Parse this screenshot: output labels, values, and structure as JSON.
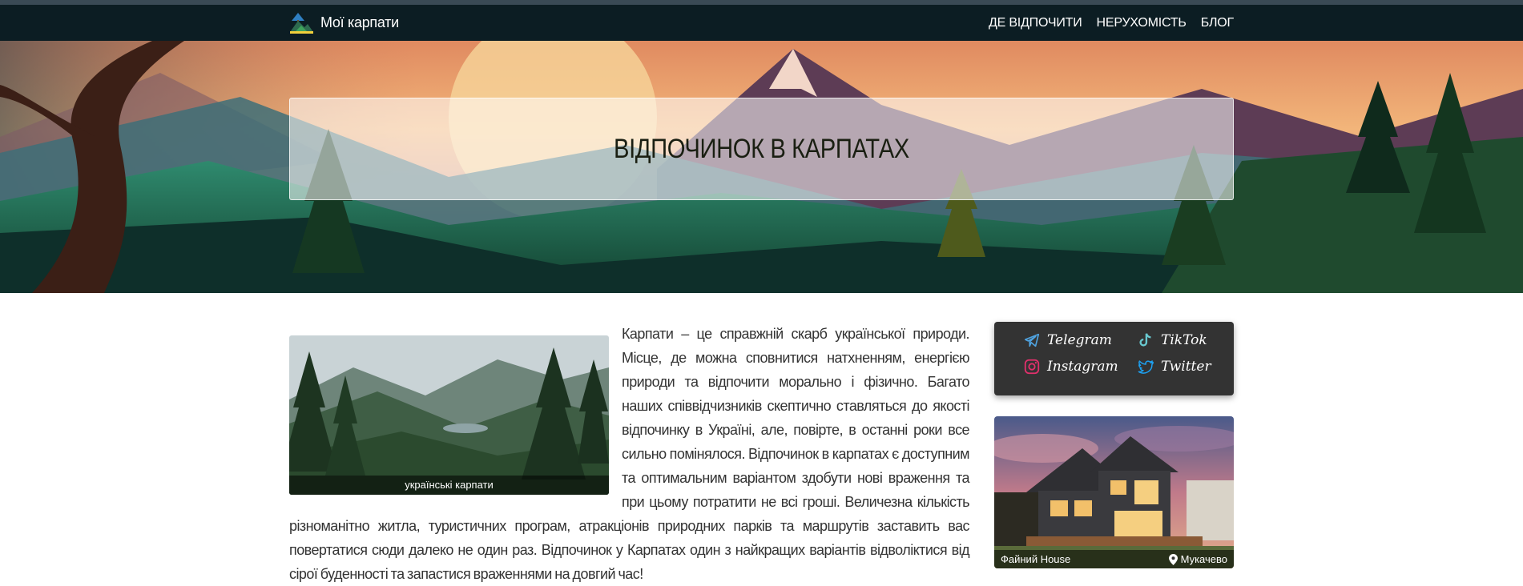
{
  "brand": {
    "name": "Мої карпати"
  },
  "nav": {
    "items": [
      "ДЕ ВІДПОЧИТИ",
      "НЕРУХОМІСТЬ",
      "БЛОГ"
    ]
  },
  "hero": {
    "title": "ВІДПОЧИНОК В КАРПАТАХ"
  },
  "article": {
    "image_caption": "українські карпати",
    "text": "Карпати – це справжній скарб української природи. Місце, де можна сповнитися натхненням, енергією природи та відпочити морально і фізично. Багато наших співвідчизників скептично ставляться до якості відпочинку в Україні, але, повірте, в останні роки все сильно помінялося. Відпочинок в карпатах є доступним та оптимальним варіантом здобути нові враження та при цьому потратити не всі гроші. Величезна кількість різноманітно житла, туристичних програм, атракціонів природних парків та маршрутів заставить вас повертатися сюди далеко не один раз. Відпочинок у Карпатах один з найкращих варіантів відволіктися від сірої буденності та запастися враженнями на довгий час!"
  },
  "social": {
    "items": [
      {
        "label": "Telegram",
        "icon": "telegram-icon",
        "color": "#4fa3e0"
      },
      {
        "label": "TikTok",
        "icon": "tiktok-icon",
        "color": "#69c9d0"
      },
      {
        "label": "Instagram",
        "icon": "instagram-icon",
        "color": "#e1306c"
      },
      {
        "label": "Twitter",
        "icon": "twitter-icon",
        "color": "#1da1f2"
      }
    ]
  },
  "property": {
    "name": "Файний House",
    "location": "Мукачево",
    "icon": "location-pin-icon"
  },
  "colors": {
    "navbar": "#0c1d23",
    "social_card": "#333333",
    "text": "#333333"
  }
}
